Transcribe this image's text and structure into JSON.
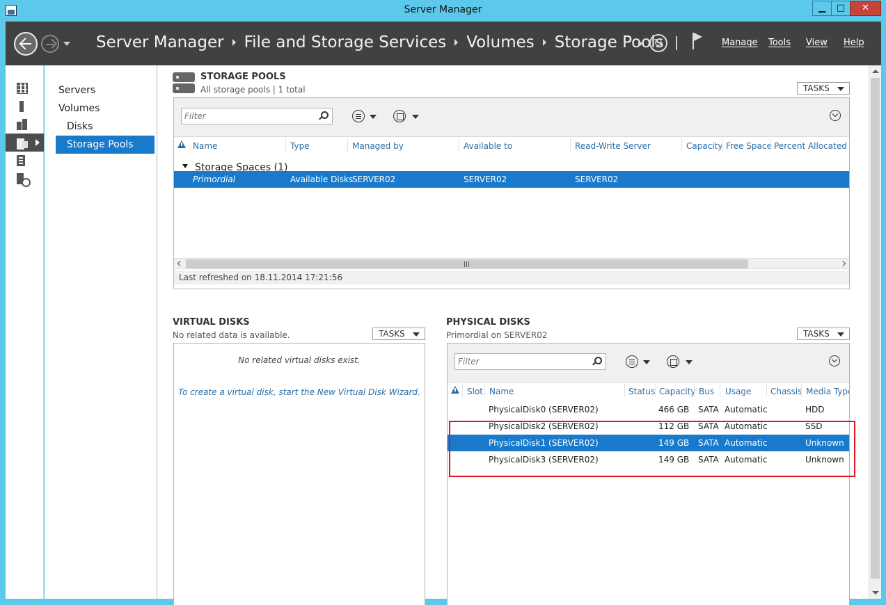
{
  "window": {
    "title": "Server Manager",
    "minimize": "▁",
    "maximize": "□",
    "close": "✕"
  },
  "header": {
    "breadcrumb": [
      "Server Manager",
      "File and Storage Services",
      "Volumes",
      "Storage Pools"
    ],
    "menus": [
      "Manage",
      "Tools",
      "View",
      "Help"
    ]
  },
  "rail": {
    "items": [
      "dashboard-icon",
      "local-server-icon",
      "all-servers-icon",
      "file-storage-icon",
      "iis-icon",
      "wsus-icon"
    ]
  },
  "nav": {
    "items": [
      {
        "label": "Servers"
      },
      {
        "label": "Volumes"
      },
      {
        "label": "Disks"
      },
      {
        "label": "Storage Pools"
      }
    ]
  },
  "storage_pools": {
    "title": "STORAGE POOLS",
    "subtitle": "All storage pools | 1 total",
    "tasks": "TASKS",
    "filter_placeholder": "Filter",
    "columns": [
      "Name",
      "Type",
      "Managed by",
      "Available to",
      "Read-Write Server",
      "Capacity",
      "Free Space",
      "Percent Allocated"
    ],
    "group": "Storage Spaces (1)",
    "rows": [
      {
        "name": "Primordial",
        "type": "Available Disks",
        "managed_by": "SERVER02",
        "available_to": "SERVER02",
        "rw_server": "SERVER02",
        "capacity": "",
        "free_space": "",
        "percent": ""
      }
    ],
    "last_refreshed": "Last refreshed on 18.11.2014 17:21:56"
  },
  "virtual_disks": {
    "title": "VIRTUAL DISKS",
    "subtitle": "No related data is available.",
    "tasks": "TASKS",
    "empty_message": "No related virtual disks exist.",
    "wizard_link": "To create a virtual disk, start the New Virtual Disk Wizard."
  },
  "physical_disks": {
    "title": "PHYSICAL DISKS",
    "subtitle": "Primordial on SERVER02",
    "tasks": "TASKS",
    "filter_placeholder": "Filter",
    "columns": [
      "Slot",
      "Name",
      "Status",
      "Capacity",
      "Bus",
      "Usage",
      "Chassis",
      "Media Type"
    ],
    "rows": [
      {
        "slot": "",
        "name": "PhysicalDisk0 (SERVER02)",
        "status": "",
        "capacity": "466 GB",
        "bus": "SATA",
        "usage": "Automatic",
        "chassis": "",
        "media": "HDD"
      },
      {
        "slot": "",
        "name": "PhysicalDisk2 (SERVER02)",
        "status": "",
        "capacity": "112 GB",
        "bus": "SATA",
        "usage": "Automatic",
        "chassis": "",
        "media": "SSD"
      },
      {
        "slot": "",
        "name": "PhysicalDisk1 (SERVER02)",
        "status": "",
        "capacity": "149 GB",
        "bus": "SATA",
        "usage": "Automatic",
        "chassis": "",
        "media": "Unknown"
      },
      {
        "slot": "",
        "name": "PhysicalDisk3 (SERVER02)",
        "status": "",
        "capacity": "149 GB",
        "bus": "SATA",
        "usage": "Automatic",
        "chassis": "",
        "media": "Unknown"
      }
    ],
    "selected_index": 2
  },
  "colors": {
    "accent": "#1979ca",
    "header_bg": "#414141",
    "frame": "#5cc8ea",
    "highlight": "#e0141e"
  }
}
